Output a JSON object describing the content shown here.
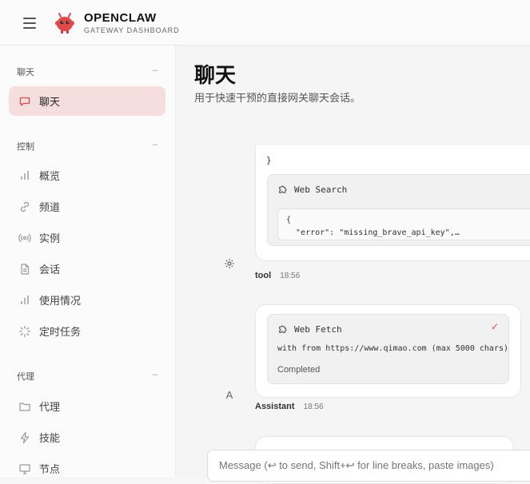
{
  "brand": {
    "title": "OPENCLAW",
    "subtitle": "GATEWAY DASHBOARD"
  },
  "sidebar": {
    "groups": [
      {
        "label": "聊天",
        "items": [
          {
            "label": "聊天",
            "icon": "chat-icon"
          }
        ]
      },
      {
        "label": "控制",
        "items": [
          {
            "label": "概览",
            "icon": "bar-chart-icon"
          },
          {
            "label": "频道",
            "icon": "link-icon"
          },
          {
            "label": "实例",
            "icon": "broadcast-icon"
          },
          {
            "label": "会话",
            "icon": "document-icon"
          },
          {
            "label": "使用情况",
            "icon": "bar-chart-icon"
          },
          {
            "label": "定时任务",
            "icon": "loader-icon"
          }
        ]
      },
      {
        "label": "代理",
        "items": [
          {
            "label": "代理",
            "icon": "folder-icon"
          },
          {
            "label": "技能",
            "icon": "lightning-icon"
          },
          {
            "label": "节点",
            "icon": "monitor-icon"
          }
        ]
      }
    ],
    "collapse_symbol": "–"
  },
  "main": {
    "title": "聊天",
    "subtitle": "用于快速干预的直接网关聊天会话。",
    "messages": [
      {
        "brace": "}",
        "tool": {
          "name": "Web Search",
          "code": [
            "{",
            "  \"error\": \"missing_brave_api_key\",…"
          ]
        },
        "role": "tool",
        "time": "18:56"
      },
      {
        "tool": {
          "name": "Web Fetch",
          "detail": "with from https://www.qimao.com (max 5000 chars)",
          "status": "Completed",
          "check": "✓"
        },
        "avatar": "A",
        "role": "Assistant",
        "time": "18:56"
      }
    ]
  },
  "composer": {
    "placeholder": "Message (↩ to send, Shift+↩ for line breaks, paste images)"
  },
  "colors": {
    "active_bg": "#f7dede",
    "accent": "#e0484a"
  }
}
